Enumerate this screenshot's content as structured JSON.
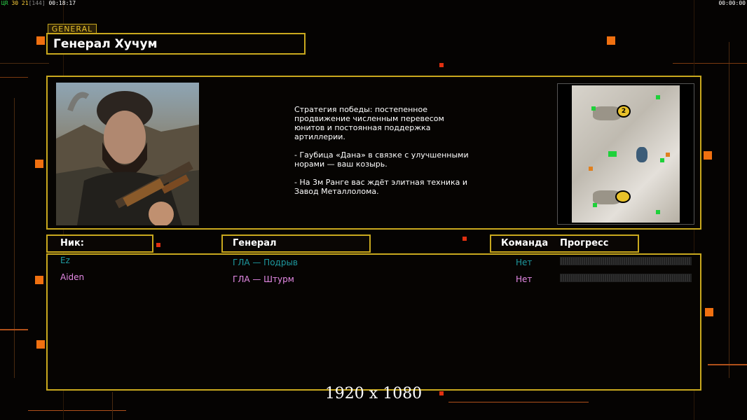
{
  "hud": {
    "left_prefix": "ЦR",
    "left_values": "30 21",
    "left_bracket": "[144]",
    "left_time": "00:18:17",
    "right_time": "00:00:00"
  },
  "general": {
    "tag": "GENERAL",
    "name": "Генерал Хучум",
    "description_1": "Стратегия победы: постепенное продвижение численным перевесом юнитов и постоянная поддержка артиллерии.",
    "description_2": "- Гаубица «Дана» в связке с улучшенными норами — ваш козырь.",
    "description_3": "- На 3м Ранге вас ждёт элитная техника и Завод Металлолома."
  },
  "map": {
    "marker_2": "2"
  },
  "table": {
    "headers": {
      "nick": "Ник:",
      "general": "Генерал",
      "team": "Команда",
      "progress": "Прогресс"
    },
    "players": [
      {
        "nick": "Ez",
        "general": "ГЛА — Подрыв",
        "team": "Нет",
        "color": "#1e9aa0",
        "progress": 0
      },
      {
        "nick": "Aiden",
        "general": "ГЛА — Штурм",
        "team": "Нет",
        "color": "#e68ae6",
        "progress": 0
      }
    ]
  },
  "overlay": {
    "resolution": "1920 x 1080"
  },
  "colors": {
    "accent": "#c9a81e",
    "orange": "#f07010"
  }
}
